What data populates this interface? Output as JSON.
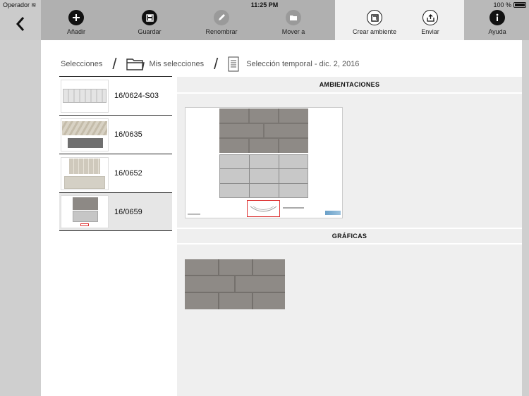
{
  "status_bar": {
    "carrier": "Operador",
    "time": "11:25 PM",
    "battery": "100 %"
  },
  "toolbar": {
    "back_icon": "chevron-left-icon",
    "items": [
      {
        "label": "Añadir",
        "icon": "plus-circle-icon"
      },
      {
        "label": "Guardar",
        "icon": "save-icon"
      },
      {
        "label": "Renombrar",
        "icon": "pencil-icon"
      },
      {
        "label": "Mover a",
        "icon": "folder-move-icon"
      },
      {
        "label": "Crear ambiente",
        "icon": "frame-icon"
      },
      {
        "label": "Enviar",
        "icon": "share-icon"
      },
      {
        "label": "Ayuda",
        "icon": "info-icon"
      }
    ]
  },
  "breadcrumb": {
    "root": "Selecciones",
    "folder": "Mis selecciones",
    "current": "Selección temporal  -  dic. 2, 2016"
  },
  "list": {
    "items": [
      {
        "code": "16/0624-S03"
      },
      {
        "code": "16/0635"
      },
      {
        "code": "16/0652"
      },
      {
        "code": "16/0659"
      }
    ],
    "selected_index": 3
  },
  "panel": {
    "ambientaciones_title": "AMBIENTACIONES",
    "graficas_title": "GRÁFICAS"
  },
  "colors": {
    "toolbar_bg": "#b0b0b0",
    "active_tab_bg": "#f0f0f0",
    "panel_bg": "#efefef"
  }
}
